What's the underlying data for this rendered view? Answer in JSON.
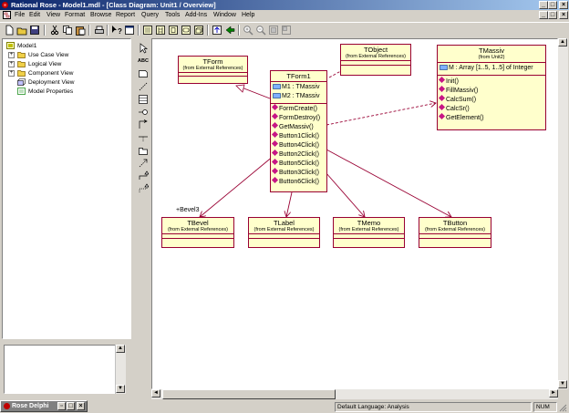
{
  "window": {
    "title": "Rational Rose - Model1.mdl - [Class Diagram: Unit1 / Overview]",
    "controls": [
      "_",
      "□",
      "×"
    ]
  },
  "menu": {
    "items": [
      "File",
      "Edit",
      "View",
      "Format",
      "Browse",
      "Report",
      "Query",
      "Tools",
      "Add-Ins",
      "Window",
      "Help"
    ],
    "doc_controls": [
      "_",
      "□",
      "×"
    ]
  },
  "toolbar": {
    "icons": [
      "new-icon",
      "open-icon",
      "save-icon",
      "cut-icon",
      "copy-icon",
      "paste-icon",
      "print-icon",
      "context-help-icon",
      "view-doc-icon",
      "browse-class-diagram-icon",
      "browse-interaction-diagram-icon",
      "browse-component-diagram-icon",
      "browse-state-diagram-icon",
      "browse-deployment-diagram-icon",
      "browse-parent-icon",
      "browse-previous-icon",
      "zoom-in-icon",
      "zoom-out-icon",
      "fit-in-window-icon",
      "undo-fit-icon"
    ]
  },
  "browser": {
    "items": [
      {
        "label": "Model1",
        "level": 0,
        "expander": "-",
        "icon": "model-icon"
      },
      {
        "label": "Use Case View",
        "level": 1,
        "expander": "+",
        "icon": "folder-icon"
      },
      {
        "label": "Logical View",
        "level": 1,
        "expander": "+",
        "icon": "folder-icon"
      },
      {
        "label": "Component View",
        "level": 1,
        "expander": "+",
        "icon": "folder-icon"
      },
      {
        "label": "Deployment View",
        "level": 1,
        "expander": "",
        "icon": "deployment-icon"
      },
      {
        "label": "Model Properties",
        "level": 1,
        "expander": "",
        "icon": "properties-icon"
      }
    ]
  },
  "toolbox": {
    "tools": [
      "selection-arrow-icon",
      "text-box-icon",
      "note-icon",
      "anchor-note-icon",
      "class-icon",
      "interface-icon",
      "unidirectional-association-icon",
      "association-class-icon",
      "package-icon",
      "dependency-icon",
      "generalization-icon",
      "realize-icon"
    ],
    "text_tool_label": "ABC"
  },
  "diagram": {
    "classes": {
      "tform": {
        "name": "TForm",
        "origin": "(from External References)"
      },
      "tobject": {
        "name": "TObject",
        "origin": "(from External References)"
      },
      "tform1": {
        "name": "TForm1",
        "attributes": [
          "M1 : TMassiv",
          "M2 : TMassiv"
        ],
        "operations": [
          "FormCreate()",
          "FormDestroy()",
          "GetMassiv()",
          "Button1Click()",
          "Button4Click()",
          "Button2Click()",
          "Button5Click()",
          "Button3Click()",
          "Button6Click()"
        ]
      },
      "tmassiv": {
        "name": "TMassiv",
        "origin": "(from Unit2)",
        "attributes": [
          "M : Array [1..5, 1..5] of Integer"
        ],
        "operations": [
          "Init()",
          "FillMassiv()",
          "CalcSum()",
          "CalcSr()",
          "GetElement()"
        ]
      },
      "tbevel": {
        "name": "TBevel",
        "origin": "(from External References)"
      },
      "tlabel": {
        "name": "TLabel",
        "origin": "(from External References)"
      },
      "tmemo": {
        "name": "TMemo",
        "origin": "(from External References)"
      },
      "tbutton": {
        "name": "TButton",
        "origin": "(from External References)"
      }
    },
    "role_label": "+Bevel3",
    "colors": {
      "class_fill": "#ffffcc",
      "class_border": "#990033",
      "relation": "#990033"
    }
  },
  "statusbar": {
    "task_label": "Rose Delphi",
    "language": "Default Language: Analysis",
    "num": "NUM"
  }
}
